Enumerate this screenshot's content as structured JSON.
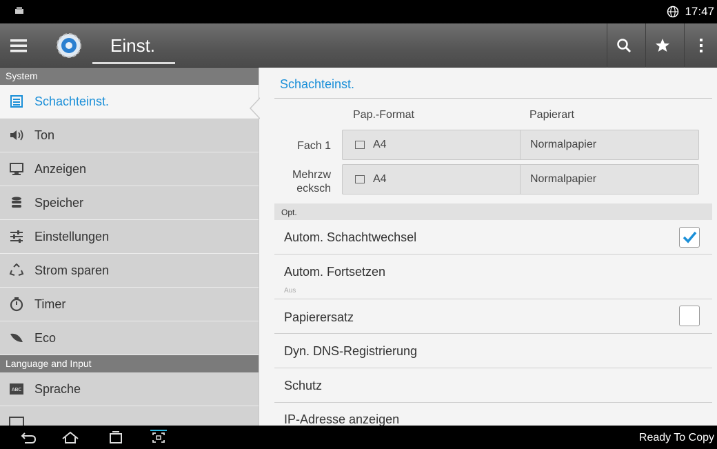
{
  "status_bar": {
    "time": "17:47",
    "left_icon": "printer-icon",
    "right_icon": "globe-icon"
  },
  "action_bar": {
    "title": "Einst.",
    "icons": [
      "menu-icon",
      "settings-gear-icon",
      "search-icon",
      "star-icon",
      "overflow-menu-icon"
    ]
  },
  "sidebar": {
    "sections": [
      {
        "header": "System",
        "items": [
          {
            "label": "Schachteinst.",
            "icon": "tray-list-icon",
            "active": true
          },
          {
            "label": "Ton",
            "icon": "speaker-icon"
          },
          {
            "label": "Anzeigen",
            "icon": "monitor-icon"
          },
          {
            "label": "Speicher",
            "icon": "storage-icon"
          },
          {
            "label": "Einstellungen",
            "icon": "sliders-icon"
          },
          {
            "label": "Strom sparen",
            "icon": "recycle-icon"
          },
          {
            "label": "Timer",
            "icon": "timer-icon"
          },
          {
            "label": "Eco",
            "icon": "leaf-icon"
          }
        ]
      },
      {
        "header": "Language and Input",
        "items": [
          {
            "label": "Sprache",
            "icon": "abc-keyboard-icon"
          }
        ]
      }
    ]
  },
  "main": {
    "title": "Schachteinst.",
    "col_format": "Pap.-Format",
    "col_type": "Papierart",
    "trays": [
      {
        "name": "Fach 1",
        "format": "A4",
        "type": "Normalpapier"
      },
      {
        "name": "Mehrzw ecksch",
        "format": "A4",
        "type": "Normalpapier"
      }
    ],
    "options_header": "Opt.",
    "options": [
      {
        "label": "Autom. Schachtwechsel",
        "checked": true
      },
      {
        "label": "Autom. Fortsetzen",
        "sub": "Aus"
      },
      {
        "label": "Papierersatz",
        "checked": false
      },
      {
        "label": "Dyn. DNS-Registrierung"
      },
      {
        "label": "Schutz"
      },
      {
        "label": "IP-Adresse anzeigen"
      }
    ]
  },
  "nav_bar": {
    "status": "Ready To Copy",
    "icons": [
      "back-icon",
      "home-icon",
      "recent-apps-icon",
      "screen-capture-icon"
    ]
  },
  "colors": {
    "accent": "#1a8fd8",
    "sidebar_bg": "#d2d2d2",
    "header_bg": "#7b7b7b"
  }
}
